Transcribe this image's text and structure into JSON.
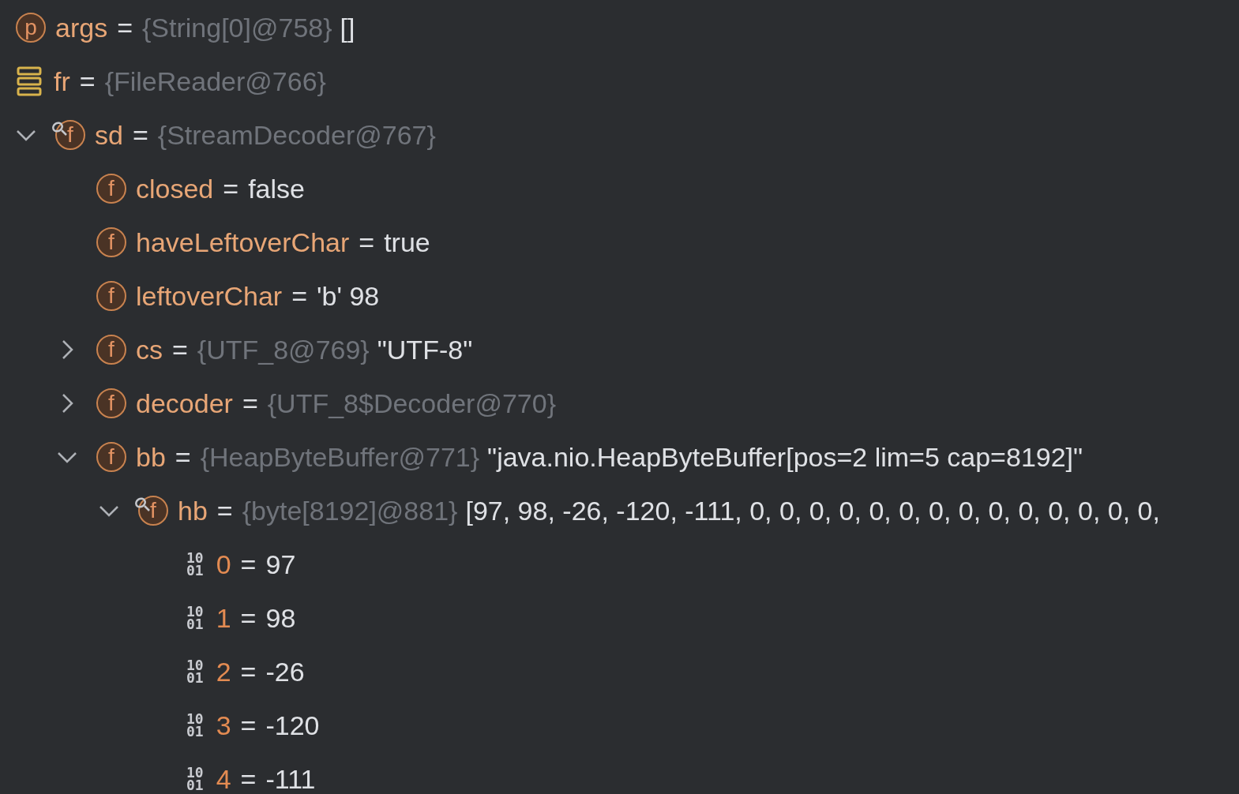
{
  "variables": [
    {
      "kind": "param",
      "icon_text": [
        "p"
      ],
      "watched": false,
      "name": "args",
      "eq": "=",
      "ref": "{String[0]@758}",
      "value": "[]"
    },
    {
      "kind": "local",
      "watched": false,
      "name": "fr",
      "eq": "=",
      "ref": "{FileReader@766}"
    },
    {
      "kind": "field",
      "icon_text": [
        "f"
      ],
      "watched": true,
      "expanded": true,
      "name": "sd",
      "eq": "=",
      "ref": "{StreamDecoder@767}",
      "children": [
        {
          "kind": "field",
          "icon_text": [
            "f"
          ],
          "watched": false,
          "name": "closed",
          "eq": "=",
          "value": "false"
        },
        {
          "kind": "field",
          "icon_text": [
            "f"
          ],
          "watched": false,
          "name": "haveLeftoverChar",
          "eq": "=",
          "value": "true"
        },
        {
          "kind": "field",
          "icon_text": [
            "f"
          ],
          "watched": false,
          "name": "leftoverChar",
          "eq": "=",
          "value": "'b' 98"
        },
        {
          "kind": "field",
          "icon_text": [
            "f"
          ],
          "watched": false,
          "expanded": false,
          "name": "cs",
          "eq": "=",
          "ref": "{UTF_8@769}",
          "value": "\"UTF-8\""
        },
        {
          "kind": "field",
          "icon_text": [
            "f"
          ],
          "watched": false,
          "expanded": false,
          "name": "decoder",
          "eq": "=",
          "ref": "{UTF_8$Decoder@770}"
        },
        {
          "kind": "field",
          "icon_text": [
            "f"
          ],
          "watched": false,
          "expanded": true,
          "name": "bb",
          "eq": "=",
          "ref": "{HeapByteBuffer@771}",
          "value": "\"java.nio.HeapByteBuffer[pos=2 lim=5 cap=8192]\"",
          "children": [
            {
              "kind": "field",
              "icon_text": [
                "f"
              ],
              "watched": true,
              "expanded": true,
              "name": "hb",
              "eq": "=",
              "ref": "{byte[8192]@881}",
              "value": "[97, 98, -26, -120, -111, 0, 0, 0, 0, 0, 0, 0, 0, 0, 0, 0, 0, 0, 0,",
              "children": [
                {
                  "kind": "element",
                  "icon_text": [
                    "10",
                    "01"
                  ],
                  "watched": false,
                  "name": "0",
                  "eq": "=",
                  "value": "97"
                },
                {
                  "kind": "element",
                  "icon_text": [
                    "10",
                    "01"
                  ],
                  "watched": false,
                  "name": "1",
                  "eq": "=",
                  "value": "98"
                },
                {
                  "kind": "element",
                  "icon_text": [
                    "10",
                    "01"
                  ],
                  "watched": false,
                  "name": "2",
                  "eq": "=",
                  "value": "-26"
                },
                {
                  "kind": "element",
                  "icon_text": [
                    "10",
                    "01"
                  ],
                  "watched": false,
                  "name": "3",
                  "eq": "=",
                  "value": "-120"
                },
                {
                  "kind": "element",
                  "icon_text": [
                    "10",
                    "01"
                  ],
                  "watched": false,
                  "name": "4",
                  "eq": "=",
                  "value": "-111"
                }
              ]
            }
          ]
        }
      ]
    }
  ]
}
